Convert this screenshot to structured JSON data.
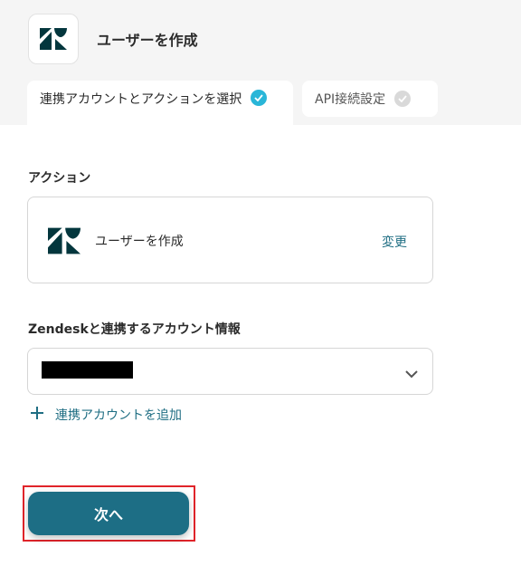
{
  "header": {
    "title": "ユーザーを作成",
    "app_icon": "zendesk-logo"
  },
  "tabs": [
    {
      "label": "連携アカウントとアクションを選択",
      "completed": true
    },
    {
      "label": "API接続設定",
      "completed": false
    }
  ],
  "action_section": {
    "label": "アクション",
    "action_name": "ユーザーを作成",
    "change_label": "変更"
  },
  "account_section": {
    "label": "Zendeskと連携するアカウント情報",
    "selected_value_redacted": true,
    "add_account_label": "連携アカウントを追加"
  },
  "footer": {
    "next_label": "次へ"
  },
  "colors": {
    "accent": "#1d6e85",
    "link": "#1f6e83",
    "check_active": "#29b6d8",
    "highlight_frame": "#e0242a"
  }
}
